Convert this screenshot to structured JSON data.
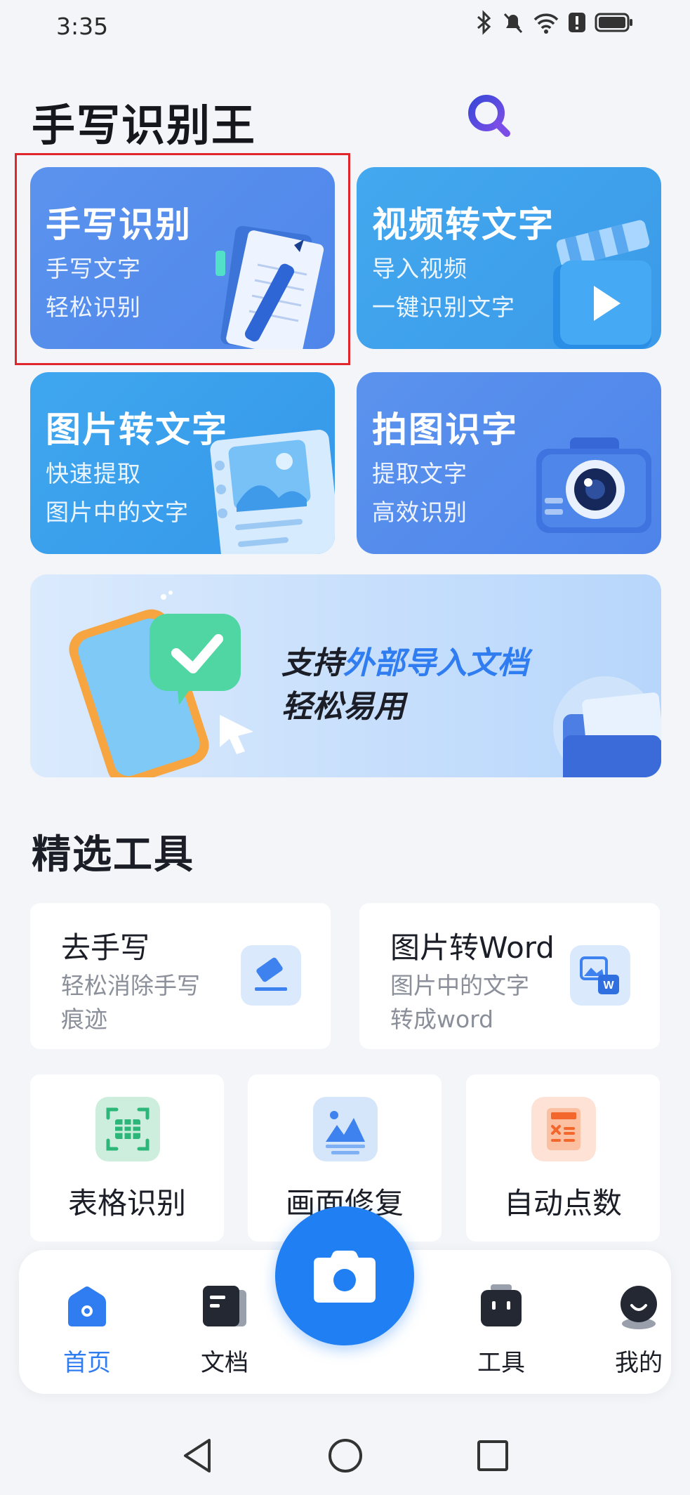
{
  "status_bar": {
    "time": "3:35"
  },
  "header": {
    "title": "手写识别王"
  },
  "feature_cards": [
    {
      "title": "手写识别",
      "line1": "手写文字",
      "line2": "轻松识别"
    },
    {
      "title": "视频转文字",
      "line1": "导入视频",
      "line2": "一键识别文字"
    },
    {
      "title": "图片转文字",
      "line1": "快速提取",
      "line2": "图片中的文字"
    },
    {
      "title": "拍图识字",
      "line1": "提取文字",
      "line2": "高效识别"
    }
  ],
  "banner": {
    "line1_prefix": "支持",
    "line1_highlight": "外部导入文档",
    "line2": "轻松易用"
  },
  "tools_section": {
    "title": "精选工具",
    "wide_tools": [
      {
        "title": "去手写",
        "desc": "轻松消除手写痕迹"
      },
      {
        "title": "图片转Word",
        "desc": "图片中的文字转成word"
      }
    ],
    "small_tools": [
      {
        "label": "表格识别"
      },
      {
        "label": "画面修复"
      },
      {
        "label": "自动点数"
      }
    ]
  },
  "bottom_nav": {
    "items": [
      {
        "label": "首页",
        "active": true
      },
      {
        "label": "文档"
      },
      {
        "label": "工具"
      },
      {
        "label": "我的"
      }
    ]
  },
  "colors": {
    "accent": "#2f7df0",
    "card_blue": "#5b93ee",
    "card_cyan": "#3fa7ee",
    "highlight_border": "#e0262c"
  },
  "icons": [
    "bluetooth-icon",
    "mute-icon",
    "wifi-icon",
    "alert-icon",
    "battery-icon",
    "search-icon",
    "eraser-icon",
    "image-word-icon",
    "table-scan-icon",
    "image-restore-icon",
    "count-icon",
    "home-icon",
    "document-icon",
    "toolbox-icon",
    "profile-icon",
    "camera-icon",
    "back-icon",
    "home-circle-icon",
    "recents-icon"
  ]
}
